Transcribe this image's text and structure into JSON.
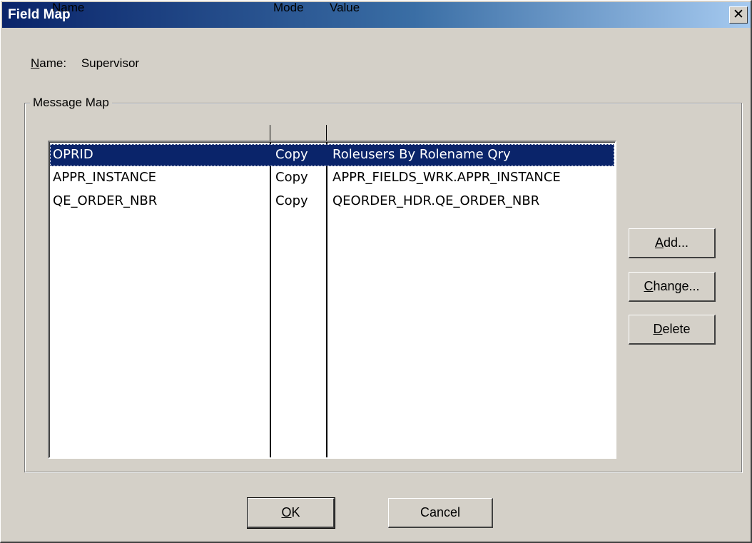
{
  "window": {
    "title": "Field Map",
    "close_glyph": "✕"
  },
  "name_field": {
    "label_access": "N",
    "label_rest": "ame:",
    "value": "Supervisor"
  },
  "message_map": {
    "group_label": "Message Map",
    "columns": [
      "Name",
      "Mode",
      "Value"
    ],
    "rows": [
      {
        "name": "OPRID",
        "mode": "Copy",
        "value": "Roleusers By Rolename Qry",
        "selected": true
      },
      {
        "name": "APPR_INSTANCE",
        "mode": "Copy",
        "value": "APPR_FIELDS_WRK.APPR_INSTANCE",
        "selected": false
      },
      {
        "name": "QE_ORDER_NBR",
        "mode": "Copy",
        "value": "QEORDER_HDR.QE_ORDER_NBR",
        "selected": false
      }
    ]
  },
  "buttons": {
    "add": {
      "access": "A",
      "rest": "dd..."
    },
    "change": {
      "access": "C",
      "rest": "hange..."
    },
    "delete": {
      "access": "D",
      "rest": "elete"
    },
    "ok": {
      "access": "O",
      "rest": "K"
    },
    "cancel": {
      "label": "Cancel"
    }
  },
  "colors": {
    "titlebar_start": "#0a246a",
    "titlebar_end": "#a6caf0",
    "selection": "#0a246a",
    "dialog_face": "#d4d0c8"
  }
}
